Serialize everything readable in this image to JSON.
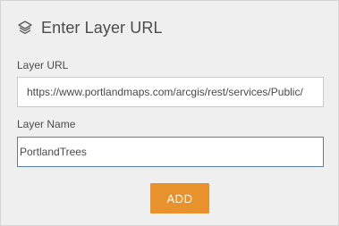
{
  "header": {
    "icon": "layers-icon",
    "title": "Enter Layer URL"
  },
  "form": {
    "layer_url": {
      "label": "Layer URL",
      "value": "https://www.portlandmaps.com/arcgis/rest/services/Public/"
    },
    "layer_name": {
      "label": "Layer Name",
      "value": "PortlandTrees"
    },
    "add_button_label": "ADD"
  },
  "colors": {
    "panel_background": "#efefef",
    "accent_button": "#e8922e",
    "focused_border": "#5b7fa6"
  }
}
